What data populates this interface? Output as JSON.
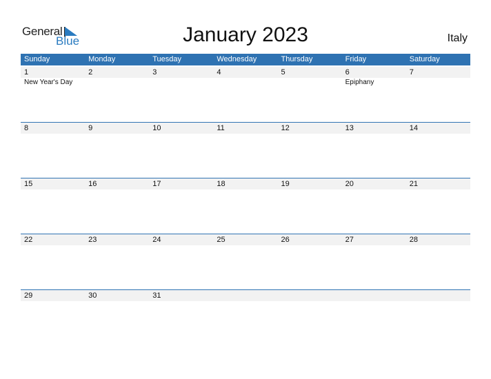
{
  "logo": {
    "line1": "General",
    "line2": "Blue"
  },
  "title": "January 2023",
  "country": "Italy",
  "colors": {
    "header": "#2e72b2",
    "date_row": "#f2f2f2",
    "logo_blue": "#2a7bc0"
  },
  "weekdays": [
    "Sunday",
    "Monday",
    "Tuesday",
    "Wednesday",
    "Thursday",
    "Friday",
    "Saturday"
  ],
  "weeks": [
    {
      "days": [
        "1",
        "2",
        "3",
        "4",
        "5",
        "6",
        "7"
      ],
      "holidays": [
        "New Year's Day",
        "",
        "",
        "",
        "",
        "Epiphany",
        ""
      ]
    },
    {
      "days": [
        "8",
        "9",
        "10",
        "11",
        "12",
        "13",
        "14"
      ],
      "holidays": [
        "",
        "",
        "",
        "",
        "",
        "",
        ""
      ]
    },
    {
      "days": [
        "15",
        "16",
        "17",
        "18",
        "19",
        "20",
        "21"
      ],
      "holidays": [
        "",
        "",
        "",
        "",
        "",
        "",
        ""
      ]
    },
    {
      "days": [
        "22",
        "23",
        "24",
        "25",
        "26",
        "27",
        "28"
      ],
      "holidays": [
        "",
        "",
        "",
        "",
        "",
        "",
        ""
      ]
    },
    {
      "days": [
        "29",
        "30",
        "31",
        "",
        "",
        "",
        ""
      ],
      "holidays": [
        "",
        "",
        "",
        "",
        "",
        "",
        ""
      ]
    }
  ]
}
